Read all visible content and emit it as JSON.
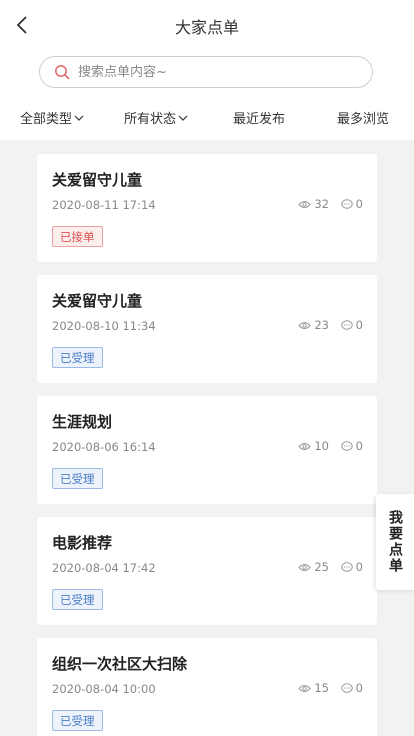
{
  "header": {
    "title": "大家点单",
    "back_icon": "chevron-left-icon"
  },
  "search": {
    "placeholder": "搜索点单内容~",
    "value": ""
  },
  "filters": [
    {
      "label": "全部类型",
      "has_dropdown": true
    },
    {
      "label": "所有状态",
      "has_dropdown": true
    },
    {
      "label": "最近发布",
      "has_dropdown": false
    },
    {
      "label": "最多浏览",
      "has_dropdown": false
    }
  ],
  "items": [
    {
      "title": "关爱留守儿童",
      "date": "2020-08-11 17:14",
      "views": "32",
      "comments": "0",
      "status": "已接单",
      "status_type": "accepted"
    },
    {
      "title": "关爱留守儿童",
      "date": "2020-08-10 11:34",
      "views": "23",
      "comments": "0",
      "status": "已受理",
      "status_type": "handled"
    },
    {
      "title": "生涯规划",
      "date": "2020-08-06 16:14",
      "views": "10",
      "comments": "0",
      "status": "已受理",
      "status_type": "handled"
    },
    {
      "title": "电影推荐",
      "date": "2020-08-04 17:42",
      "views": "25",
      "comments": "0",
      "status": "已受理",
      "status_type": "handled"
    },
    {
      "title": "组织一次社区大扫除",
      "date": "2020-08-04 10:00",
      "views": "15",
      "comments": "0",
      "status": "已受理",
      "status_type": "handled"
    }
  ],
  "float_button": {
    "label": "我要点单"
  },
  "colors": {
    "accepted": "#e05050",
    "handled": "#4a7cc8",
    "list_bg": "#f2f2f2",
    "search_icon": "#e07070"
  }
}
